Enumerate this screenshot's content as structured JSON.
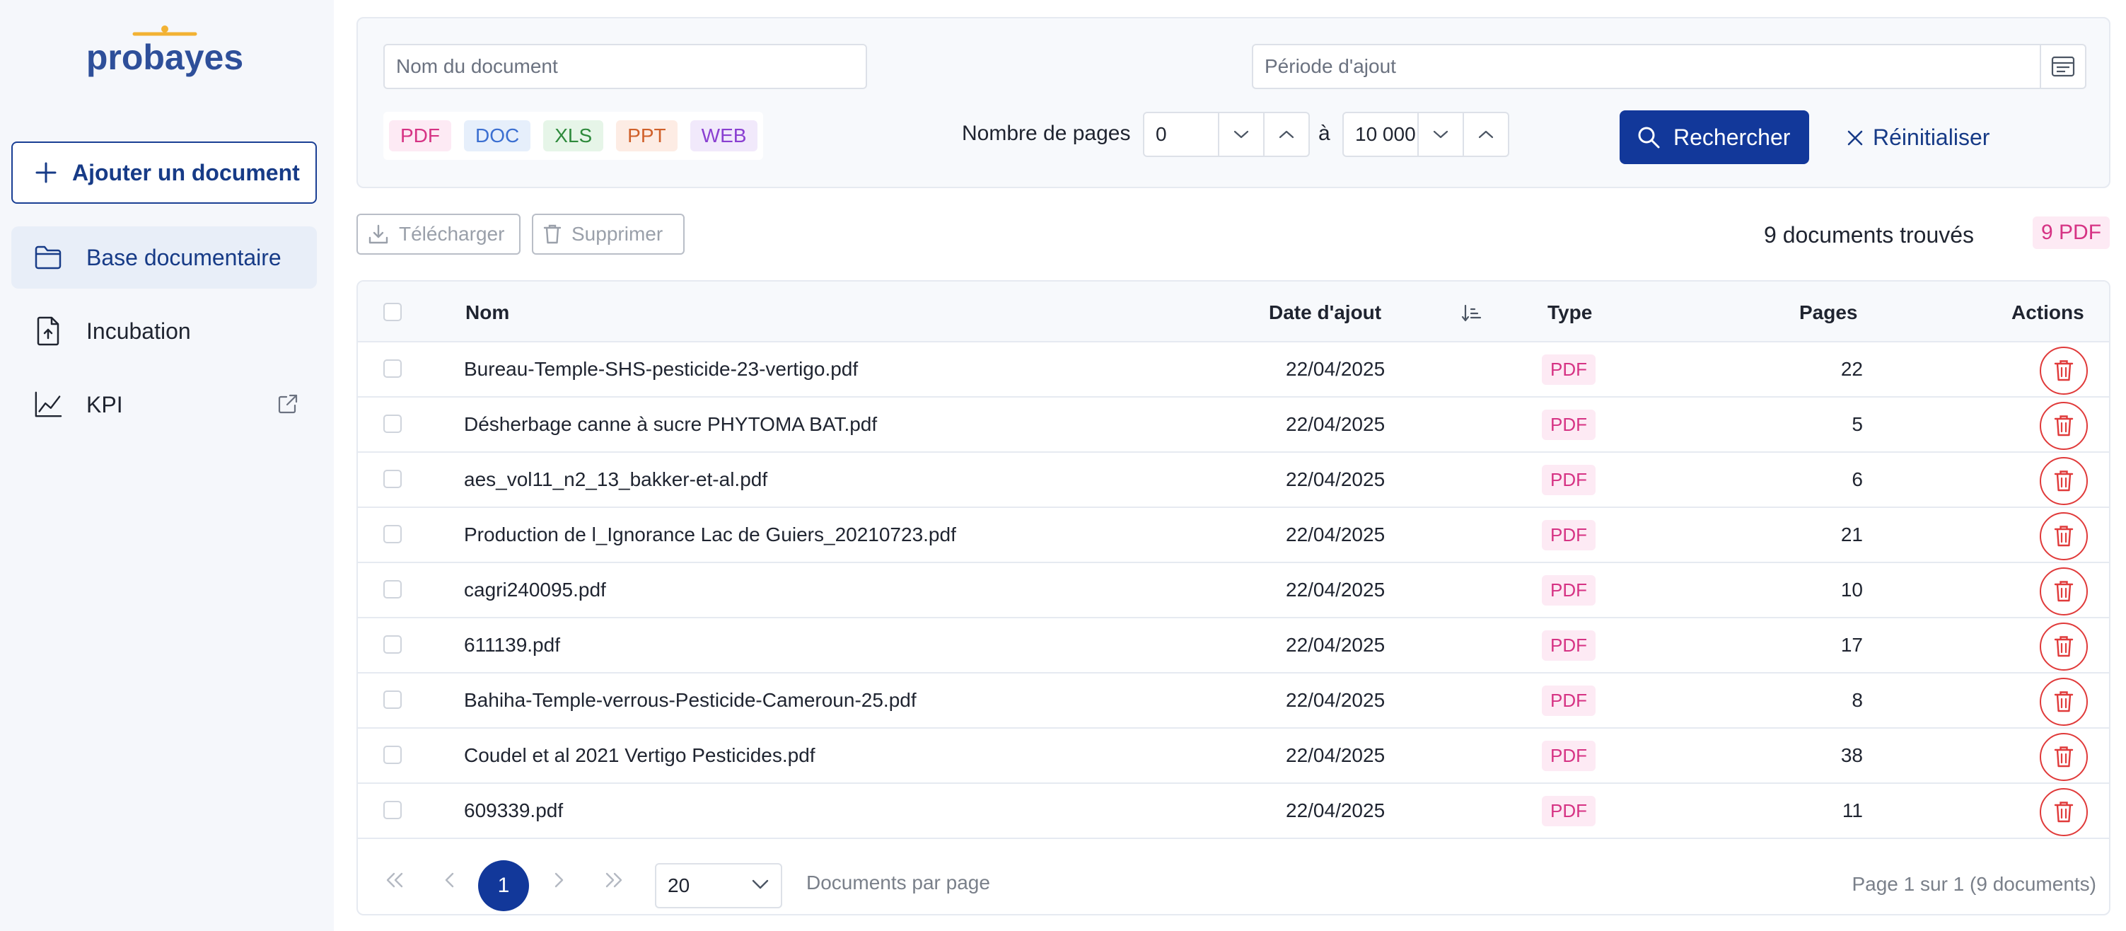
{
  "app": {
    "brand": "probayes"
  },
  "sidebar": {
    "add_button": "Ajouter un document",
    "items": [
      {
        "label": "Base documentaire",
        "icon": "folder-icon",
        "active": true
      },
      {
        "label": "Incubation",
        "icon": "file-upload-icon",
        "active": false
      },
      {
        "label": "KPI",
        "icon": "chart-line-icon",
        "active": false,
        "external": true
      }
    ]
  },
  "filters": {
    "name_placeholder": "Nom du document",
    "period_placeholder": "Période d'ajout",
    "types": [
      "PDF",
      "DOC",
      "XLS",
      "PPT",
      "WEB"
    ],
    "pages_label": "Nombre de pages",
    "pages_min": "0",
    "pages_to": "à",
    "pages_max": "10 000",
    "search_button": "Rechercher",
    "reset_button": "Réinitialiser"
  },
  "toolbar": {
    "download": "Télécharger",
    "delete": "Supprimer",
    "found": "9 documents trouvés",
    "found_badge": "9 PDF"
  },
  "table": {
    "headers": {
      "name": "Nom",
      "date": "Date d'ajout",
      "type": "Type",
      "pages": "Pages",
      "actions": "Actions"
    },
    "rows": [
      {
        "name": "Bureau-Temple-SHS-pesticide-23-vertigo.pdf",
        "date": "22/04/2025",
        "type": "PDF",
        "pages": "22"
      },
      {
        "name": "Désherbage canne à sucre PHYTOMA BAT.pdf",
        "date": "22/04/2025",
        "type": "PDF",
        "pages": "5"
      },
      {
        "name": "aes_vol11_n2_13_bakker-et-al.pdf",
        "date": "22/04/2025",
        "type": "PDF",
        "pages": "6"
      },
      {
        "name": "Production de l_Ignorance Lac de Guiers_20210723.pdf",
        "date": "22/04/2025",
        "type": "PDF",
        "pages": "21"
      },
      {
        "name": "cagri240095.pdf",
        "date": "22/04/2025",
        "type": "PDF",
        "pages": "10"
      },
      {
        "name": "611139.pdf",
        "date": "22/04/2025",
        "type": "PDF",
        "pages": "17"
      },
      {
        "name": "Bahiha-Temple-verrous-Pesticide-Cameroun-25.pdf",
        "date": "22/04/2025",
        "type": "PDF",
        "pages": "8"
      },
      {
        "name": "Coudel et al 2021 Vertigo Pesticides.pdf",
        "date": "22/04/2025",
        "type": "PDF",
        "pages": "38"
      },
      {
        "name": "609339.pdf",
        "date": "22/04/2025",
        "type": "PDF",
        "pages": "11"
      }
    ]
  },
  "pagination": {
    "current_page": "1",
    "per_page": "20",
    "per_page_label": "Documents par page",
    "info": "Page 1 sur 1 (9 documents)"
  },
  "colors": {
    "primary": "#12389a",
    "pdf": "#d63384",
    "danger": "#e03a3a"
  }
}
